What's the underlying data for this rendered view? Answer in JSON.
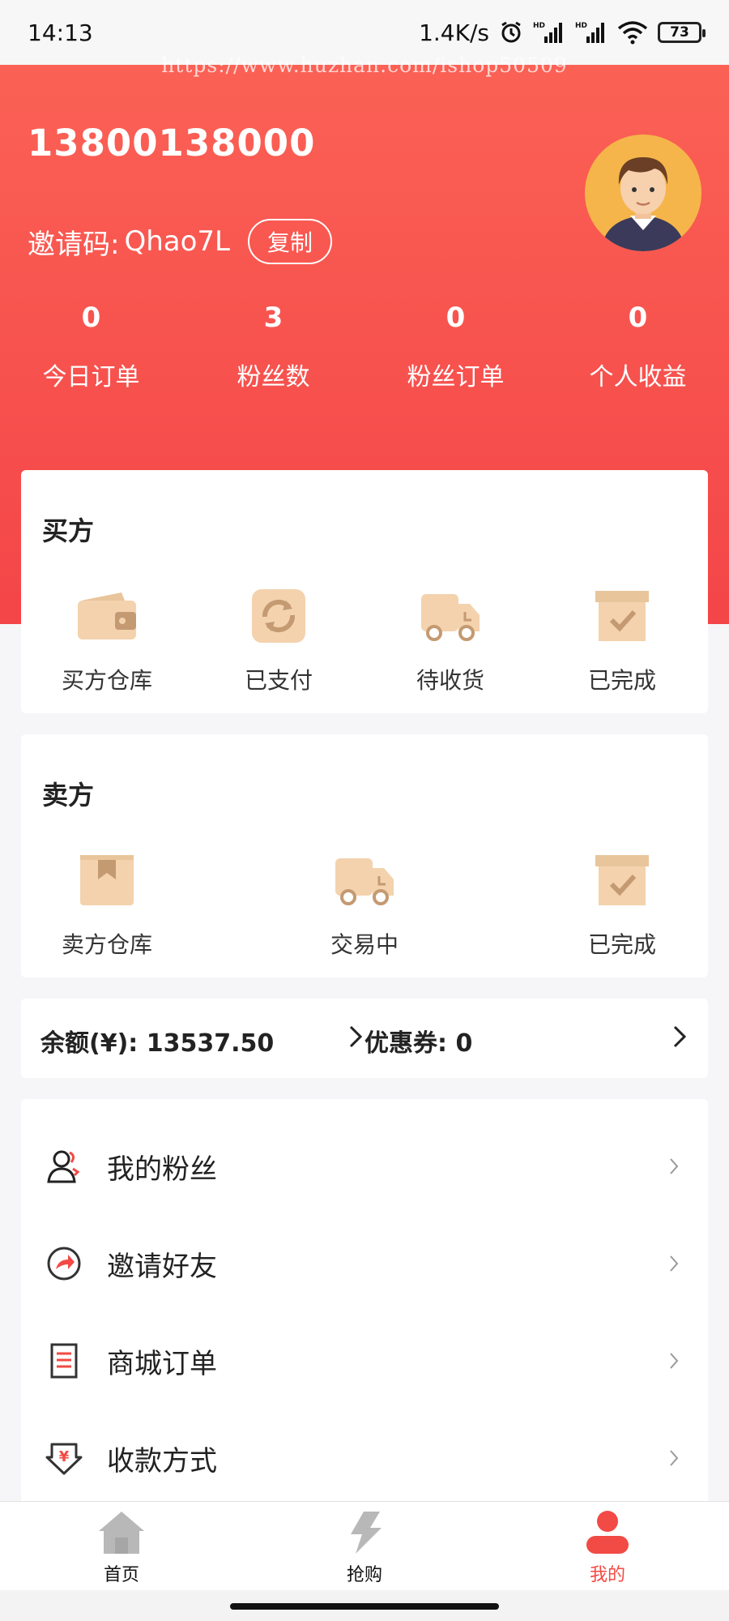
{
  "status_bar": {
    "time": "14:13",
    "network_speed": "1.4K/s",
    "battery": "73"
  },
  "watermark": "https://www.huzhan.com/ishop50509",
  "profile": {
    "phone": "13800138000",
    "invite_label": "邀请码:",
    "invite_code": "Qhao7L",
    "copy_label": "复制"
  },
  "stats": [
    {
      "value": "0",
      "label": "今日订单"
    },
    {
      "value": "3",
      "label": "粉丝数"
    },
    {
      "value": "0",
      "label": "粉丝订单"
    },
    {
      "value": "0",
      "label": "个人收益"
    }
  ],
  "buyer": {
    "title": "买方",
    "items": [
      {
        "label": "买方仓库",
        "icon": "wallet-icon"
      },
      {
        "label": "已支付",
        "icon": "refresh-icon"
      },
      {
        "label": "待收货",
        "icon": "truck-icon"
      },
      {
        "label": "已完成",
        "icon": "box-check-icon"
      }
    ]
  },
  "seller": {
    "title": "卖方",
    "items": [
      {
        "label": "卖方仓库",
        "icon": "package-icon"
      },
      {
        "label": "交易中",
        "icon": "truck-icon"
      },
      {
        "label": "已完成",
        "icon": "box-check-icon"
      }
    ]
  },
  "balance": {
    "balance_text": "余额(¥): 13537.50",
    "coupon_text": "优惠券: 0"
  },
  "menu": [
    {
      "label": "我的粉丝",
      "icon": "fans-icon"
    },
    {
      "label": "邀请好友",
      "icon": "share-icon"
    },
    {
      "label": "商城订单",
      "icon": "order-icon"
    },
    {
      "label": "收款方式",
      "icon": "payment-icon"
    }
  ],
  "tabbar": [
    {
      "label": "首页",
      "icon": "home-icon"
    },
    {
      "label": "抢购",
      "icon": "lightning-icon"
    },
    {
      "label": "我的",
      "icon": "user-icon"
    }
  ],
  "colors": {
    "accent": "#f24a44",
    "header_top": "#fb6155",
    "icon_tan": "#f3d2ad",
    "icon_dark": "#c49a72"
  }
}
